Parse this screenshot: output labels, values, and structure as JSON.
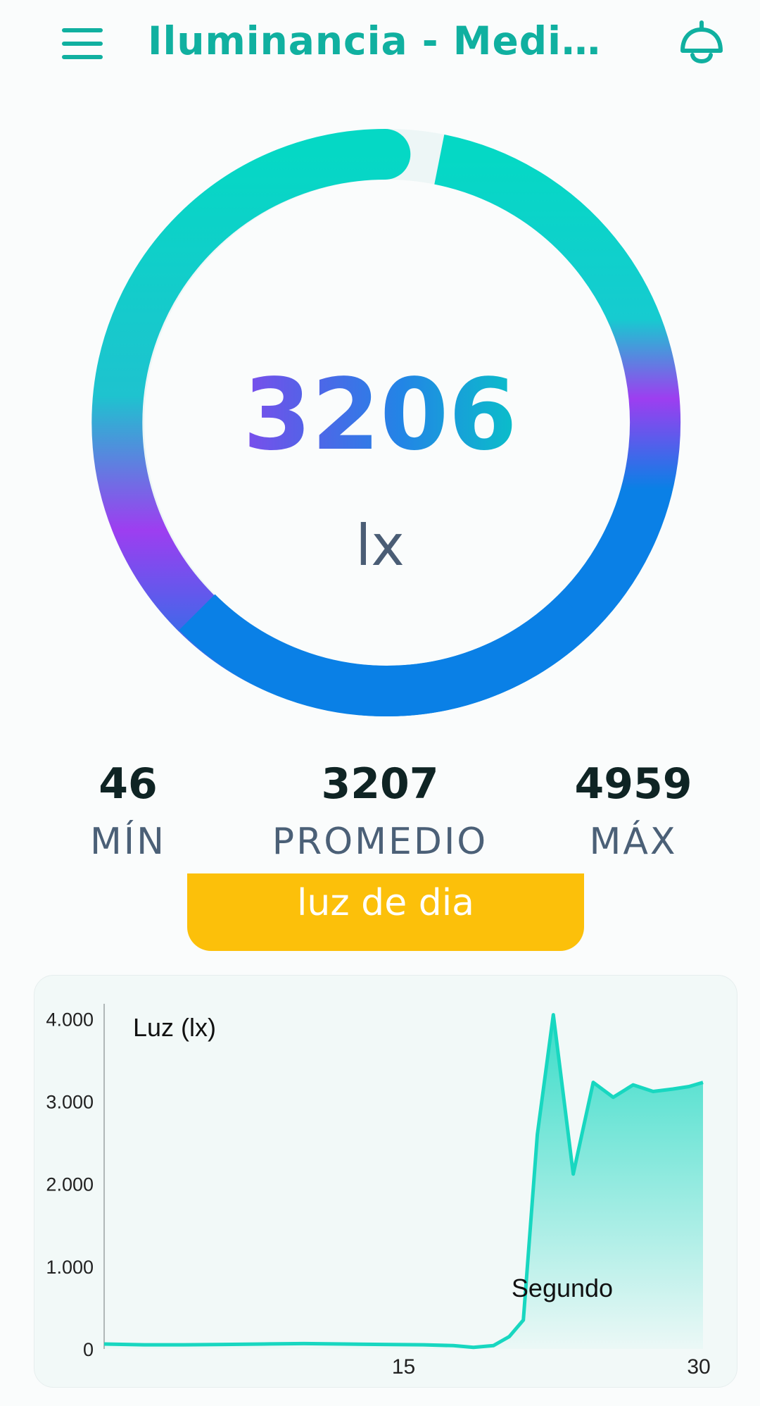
{
  "header": {
    "title": "Iluminancia - Medidor …",
    "menu_icon": "hamburger-menu-icon",
    "lamp_icon": "ceiling-lamp-icon"
  },
  "gauge": {
    "value": "3206",
    "unit": "lx"
  },
  "stats": {
    "min_value": "46",
    "min_label": "MÍN",
    "avg_value": "3207",
    "avg_label": "PROMEDIO",
    "max_value": "4959",
    "max_label": "MÁX"
  },
  "badge": {
    "label": "luz de dia"
  },
  "colors": {
    "accent": "#10b0a0",
    "gauge_teal": "#05d8c5",
    "gauge_blue": "#0a80e6",
    "gauge_purple": "#9d3ef0",
    "badge": "#fcc00a",
    "line": "#18d7c0"
  },
  "chart_data": {
    "type": "area",
    "title": "",
    "series_label": "Luz (lx)",
    "xlabel": "Segundo",
    "ylabel": "",
    "xlim": [
      0,
      30
    ],
    "ylim": [
      0,
      4200
    ],
    "x_ticks": [
      15,
      30
    ],
    "y_ticks": [
      0,
      1000,
      2000,
      3000,
      4000
    ],
    "y_tick_labels": [
      "0",
      "1.000",
      "2.000",
      "3.000",
      "4.000"
    ],
    "x_tick_labels": [
      "15",
      "30"
    ],
    "grid": false,
    "x": [
      0,
      2,
      4,
      6,
      8,
      10,
      12,
      14,
      16,
      17.5,
      18.5,
      19.5,
      20.3,
      21,
      21.7,
      22.5,
      23.5,
      24.5,
      25.5,
      26.5,
      27.5,
      28.5,
      29.3,
      30
    ],
    "y": [
      60,
      50,
      50,
      55,
      60,
      65,
      60,
      55,
      50,
      40,
      20,
      40,
      150,
      350,
      2600,
      4050,
      2120,
      3230,
      3050,
      3200,
      3120,
      3150,
      3180,
      3230
    ]
  }
}
